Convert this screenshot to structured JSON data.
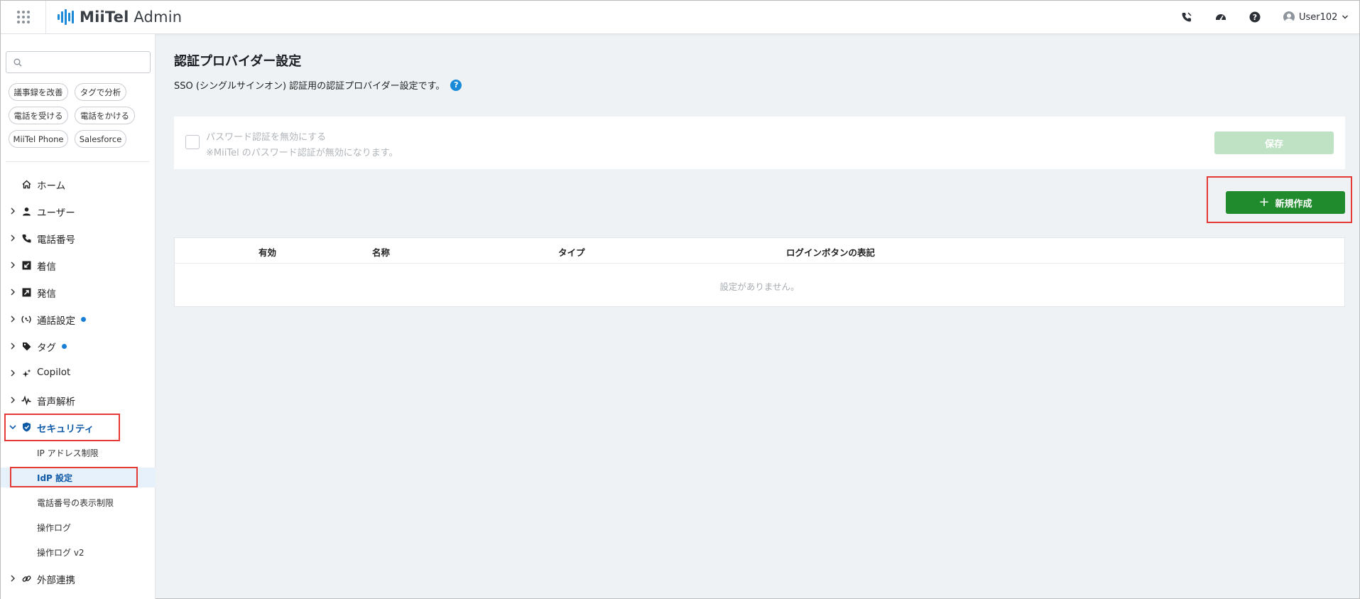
{
  "header": {
    "app_name_bold": "MiiTel",
    "app_name_rest": " Admin",
    "icons": [
      "apps-grid-icon",
      "phone-gesture-icon",
      "speedometer-icon",
      "help-icon"
    ],
    "user_name": "User102"
  },
  "sidebar": {
    "search_placeholder": "",
    "chips": [
      "議事録を改善",
      "タグで分析",
      "電話を受ける",
      "電話をかける",
      "MiiTel Phone",
      "Salesforce"
    ],
    "items": [
      {
        "label": "ホーム",
        "icon": "home-icon"
      },
      {
        "label": "ユーザー",
        "icon": "person-icon"
      },
      {
        "label": "電話番号",
        "icon": "phone-icon"
      },
      {
        "label": "着信",
        "icon": "incoming-call-icon"
      },
      {
        "label": "発信",
        "icon": "outgoing-call-icon"
      },
      {
        "label": "通話設定",
        "icon": "call-settings-icon"
      },
      {
        "label": "タグ",
        "icon": "tag-icon"
      },
      {
        "label": "Copilot",
        "icon": "sparkle-icon"
      },
      {
        "label": "音声解析",
        "icon": "waveform-icon"
      },
      {
        "label": "セキュリティ",
        "icon": "shield-icon"
      },
      {
        "label": "外部連携",
        "icon": "link-icon"
      }
    ],
    "security_sub": [
      "IP アドレス制限",
      "IdP 設定",
      "電話番号の表示制限",
      "操作ログ",
      "操作ログ v2"
    ],
    "accent_color": "#0f5aa6",
    "badge_color": "#1a7fd6"
  },
  "main": {
    "title": "認証プロバイダー設定",
    "description": "SSO (シングルサインオン) 認証用の認証プロバイダー設定です。",
    "help": "?",
    "password_panel": {
      "line1": "パスワード認証を無効にする",
      "line2": "※MiiTel のパスワード認証が無効になります。",
      "save_label": "保存"
    },
    "new_button": {
      "plus": "+",
      "label": "新規作成"
    },
    "table": {
      "columns": [
        "有効",
        "名称",
        "タイプ",
        "ログインボタンの表記"
      ],
      "empty_text": "設定がありません。"
    },
    "primary_color": "#1f8b2c"
  }
}
